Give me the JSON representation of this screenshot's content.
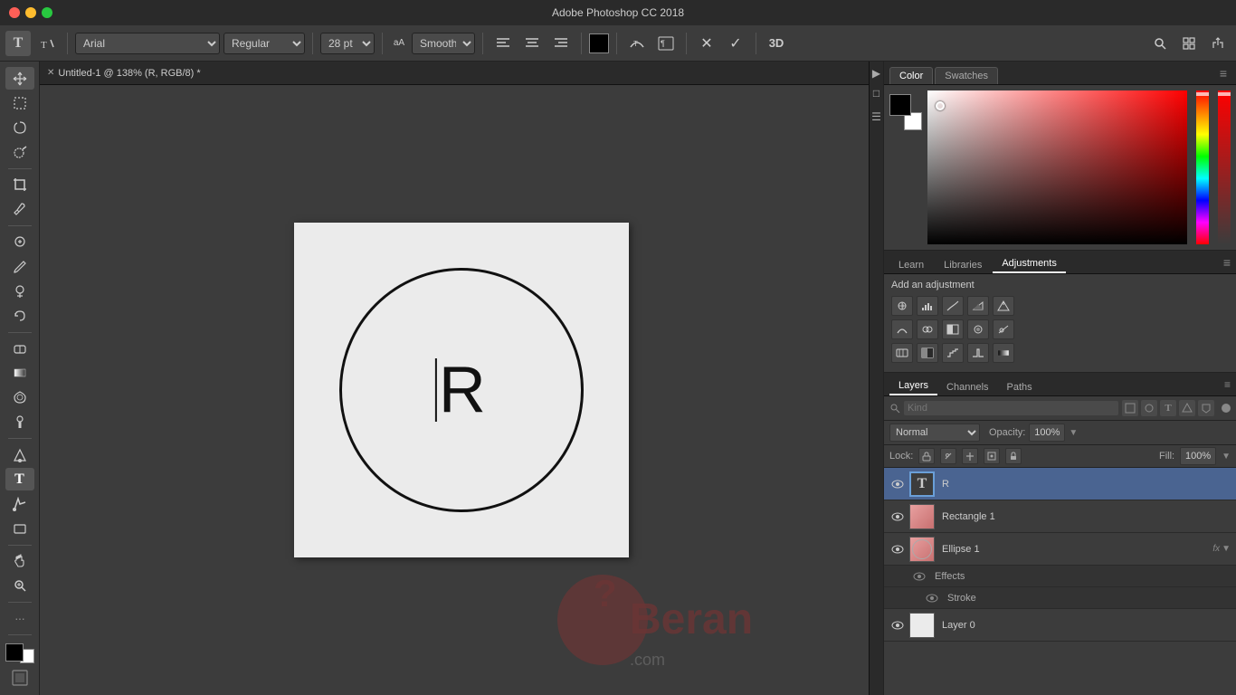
{
  "app": {
    "title": "Adobe Photoshop CC 2018",
    "window_title": "Untitled-1 @ 138% (R, RGB/8) *"
  },
  "toolbar": {
    "font_family": "Arial",
    "font_style": "Regular",
    "font_size": "28 pt",
    "antialiasing": "Smooth",
    "align_left": "≡",
    "align_center": "≡",
    "align_right": "≡",
    "cancel_label": "✕",
    "confirm_label": "✓",
    "three_d_label": "3D"
  },
  "left_tools": [
    {
      "name": "move",
      "icon": "✛",
      "tooltip": "Move Tool"
    },
    {
      "name": "marquee",
      "icon": "⬜",
      "tooltip": "Marquee"
    },
    {
      "name": "lasso",
      "icon": "⭕",
      "tooltip": "Lasso"
    },
    {
      "name": "quick-select",
      "icon": "🖌",
      "tooltip": "Quick Select"
    },
    {
      "name": "crop",
      "icon": "⬛",
      "tooltip": "Crop"
    },
    {
      "name": "eyedropper",
      "icon": "💉",
      "tooltip": "Eyedropper"
    },
    {
      "name": "heal",
      "icon": "⚕",
      "tooltip": "Healing"
    },
    {
      "name": "brush",
      "icon": "✏",
      "tooltip": "Brush"
    },
    {
      "name": "clone",
      "icon": "⊕",
      "tooltip": "Clone"
    },
    {
      "name": "history",
      "icon": "↺",
      "tooltip": "History"
    },
    {
      "name": "eraser",
      "icon": "◻",
      "tooltip": "Eraser"
    },
    {
      "name": "gradient",
      "icon": "▦",
      "tooltip": "Gradient"
    },
    {
      "name": "blur",
      "icon": "◈",
      "tooltip": "Blur"
    },
    {
      "name": "dodge",
      "icon": "◖",
      "tooltip": "Dodge"
    },
    {
      "name": "pen",
      "icon": "✒",
      "tooltip": "Pen"
    },
    {
      "name": "text",
      "icon": "T",
      "tooltip": "Text",
      "active": true
    },
    {
      "name": "path-select",
      "icon": "↗",
      "tooltip": "Path Select"
    },
    {
      "name": "shape",
      "icon": "▭",
      "tooltip": "Shape"
    },
    {
      "name": "hand",
      "icon": "✋",
      "tooltip": "Hand"
    },
    {
      "name": "zoom",
      "icon": "🔍",
      "tooltip": "Zoom"
    },
    {
      "name": "more",
      "icon": "…",
      "tooltip": "More"
    }
  ],
  "color_panel": {
    "tabs": [
      {
        "label": "Color",
        "active": true
      },
      {
        "label": "Swatches",
        "active": false
      }
    ]
  },
  "adjustments_panel": {
    "tabs": [
      {
        "label": "Learn",
        "active": false
      },
      {
        "label": "Libraries",
        "active": false
      },
      {
        "label": "Adjustments",
        "active": true
      }
    ],
    "title": "Add an adjustment",
    "icons_row1": [
      "☀",
      "▲",
      "⊞",
      "▽",
      "△"
    ],
    "icons_row2": [
      "⬡",
      "⚖",
      "▤",
      "◉",
      "⬡"
    ],
    "icons_row3": [
      "⬚",
      "⬚",
      "▣",
      "⬚",
      "▪"
    ]
  },
  "layers_panel": {
    "tabs": [
      {
        "label": "Layers",
        "active": true
      },
      {
        "label": "Channels",
        "active": false
      },
      {
        "label": "Paths",
        "active": false
      }
    ],
    "search_placeholder": "Kind",
    "blend_mode": "Normal",
    "opacity": "100%",
    "fill": "100%",
    "lock_label": "Lock:",
    "layers": [
      {
        "name": "R",
        "type": "text",
        "visible": true,
        "active": true,
        "thumb_type": "text"
      },
      {
        "name": "Rectangle 1",
        "type": "shape",
        "visible": true,
        "active": false,
        "thumb_type": "pink-rect"
      },
      {
        "name": "Ellipse 1",
        "type": "shape",
        "visible": true,
        "active": false,
        "thumb_type": "pink-ellipse",
        "has_fx": true,
        "expanded": true,
        "sub_items": [
          {
            "name": "Effects",
            "eye": true
          },
          {
            "name": "Stroke",
            "eye": true
          }
        ]
      },
      {
        "name": "Layer 0",
        "type": "raster",
        "visible": true,
        "active": false,
        "thumb_type": "white"
      }
    ]
  },
  "canvas": {
    "text": "R",
    "zoom": "138%"
  }
}
